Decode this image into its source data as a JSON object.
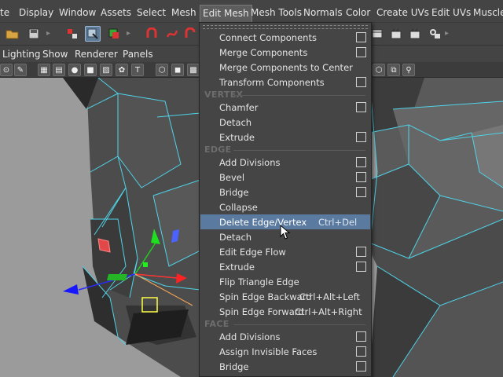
{
  "menubar": {
    "items": [
      "te",
      "Display",
      "Window",
      "Assets",
      "Select",
      "Mesh",
      "Edit Mesh",
      "Mesh Tools",
      "Normals",
      "Color",
      "Create UVs",
      "Edit UVs",
      "Muscle"
    ]
  },
  "panel_menu": {
    "items": [
      "Lighting",
      "Show",
      "Renderer",
      "Panels"
    ]
  },
  "edit_mesh_menu": {
    "items": [
      {
        "label": "Connect Components",
        "option": true
      },
      {
        "label": "Merge Components",
        "option": true
      },
      {
        "label": "Merge Components to Center",
        "option": false
      },
      {
        "label": "Transform Components",
        "option": true
      },
      {
        "section": "VERTEX"
      },
      {
        "label": "Chamfer",
        "option": true
      },
      {
        "label": "Detach",
        "option": false
      },
      {
        "label": "Extrude",
        "option": true
      },
      {
        "section": "EDGE"
      },
      {
        "label": "Add Divisions",
        "option": true
      },
      {
        "label": "Bevel",
        "option": true
      },
      {
        "label": "Bridge",
        "option": true
      },
      {
        "label": "Collapse",
        "option": false
      },
      {
        "label": "Delete Edge/Vertex",
        "shortcut": "Ctrl+Del",
        "option": false,
        "highlighted": true
      },
      {
        "label": "Detach",
        "option": false
      },
      {
        "label": "Edit Edge Flow",
        "option": true
      },
      {
        "label": "Extrude",
        "option": true
      },
      {
        "label": "Flip Triangle Edge",
        "option": false
      },
      {
        "label": "Spin Edge Backward",
        "shortcut": "Ctrl+Alt+Left",
        "option": false
      },
      {
        "label": "Spin Edge Forward",
        "shortcut": "Ctrl+Alt+Right",
        "option": false
      },
      {
        "section": "FACE"
      },
      {
        "label": "Add Divisions",
        "option": true
      },
      {
        "label": "Assign Invisible Faces",
        "option": true
      },
      {
        "label": "Bridge",
        "option": true
      }
    ]
  },
  "colors": {
    "highlight": "#5a7aa0",
    "wireframe": "#4fd3e8",
    "viewport_bg": "#9b9b9b"
  }
}
